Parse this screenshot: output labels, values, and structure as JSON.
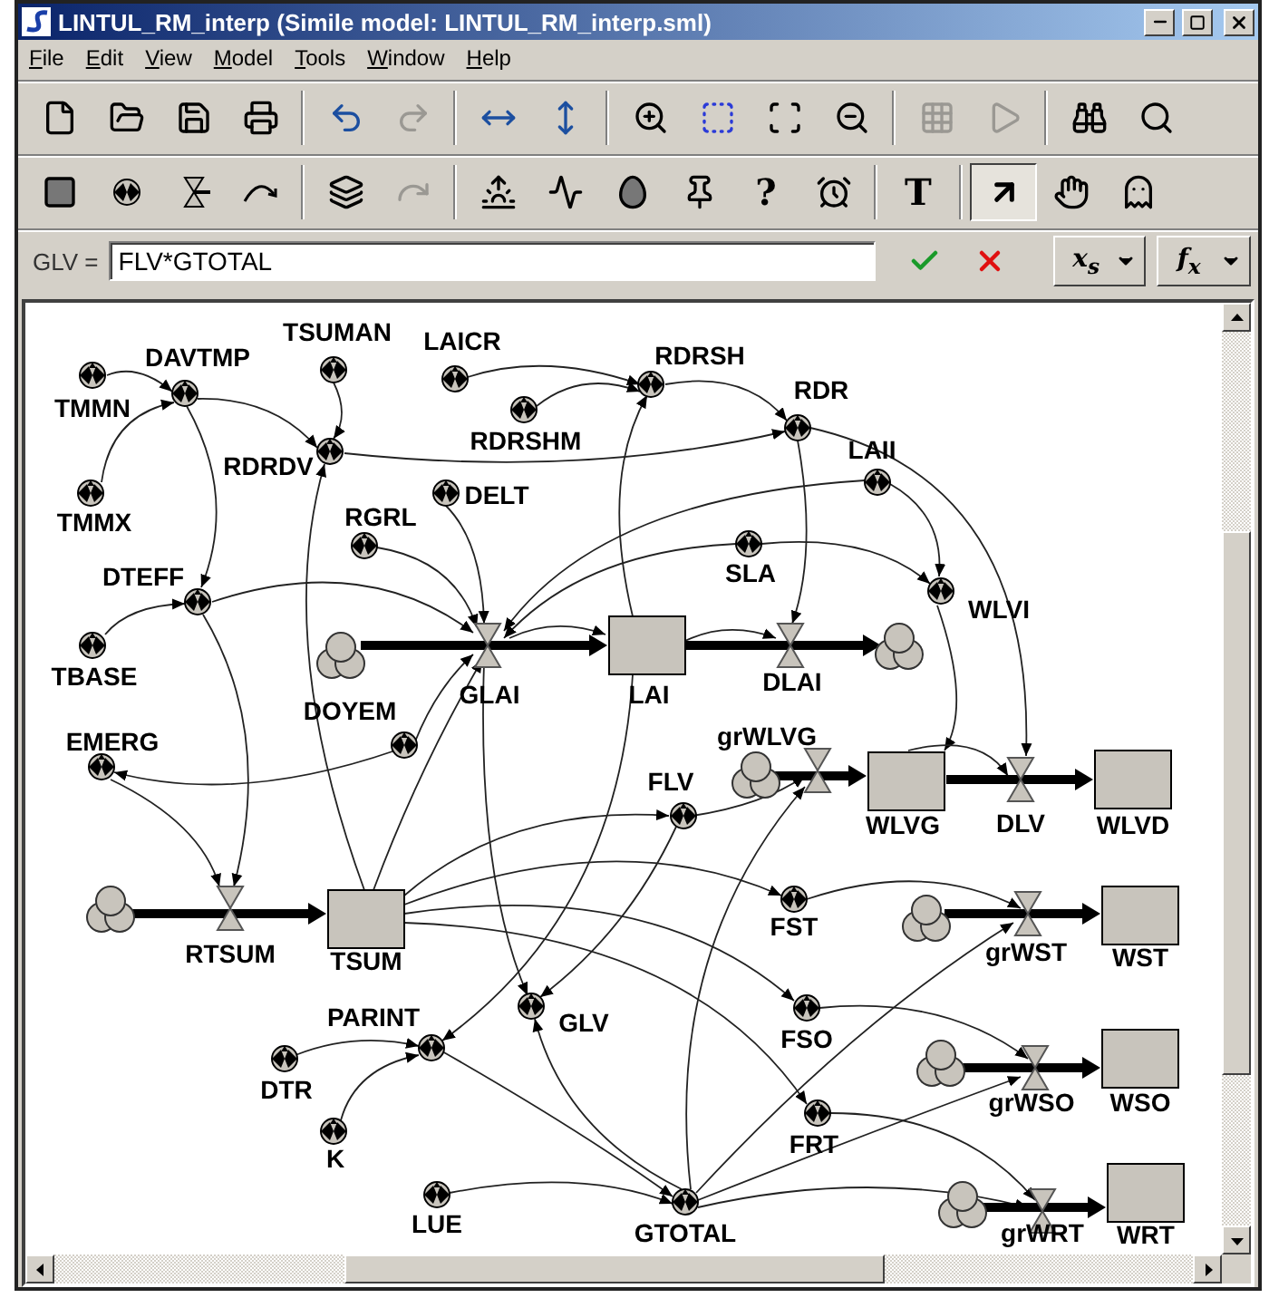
{
  "window": {
    "title": "LINTUL_RM_interp (Simile model: LINTUL_RM_interp.sml)"
  },
  "menu": [
    "File",
    "Edit",
    "View",
    "Model",
    "Tools",
    "Window",
    "Help"
  ],
  "toolbars": [
    [
      {
        "disabled": false
      },
      {
        "disabled": false
      },
      {
        "disabled": false
      },
      {
        "disabled": false
      },
      {
        "disabled": false
      },
      {
        "disabled": true
      },
      {
        "disabled": false
      },
      {
        "disabled": false
      },
      {
        "disabled": false
      },
      {
        "disabled": false
      },
      {
        "disabled": false
      },
      {
        "disabled": false
      },
      {
        "disabled": true
      },
      {
        "disabled": true
      },
      {
        "disabled": false
      },
      {
        "disabled": false
      }
    ],
    [
      {
        "disabled": false,
        "selected": false
      },
      {
        "disabled": false,
        "selected": false
      },
      {
        "disabled": false,
        "selected": false
      },
      {
        "disabled": false,
        "selected": false
      },
      {
        "disabled": false,
        "selected": false
      },
      {
        "disabled": true,
        "selected": false
      },
      {
        "disabled": false,
        "selected": false
      },
      {
        "disabled": false,
        "selected": false
      },
      {
        "disabled": false,
        "selected": false
      },
      {
        "disabled": false,
        "selected": false
      },
      {
        "text": "?",
        "disabled": false,
        "selected": false
      },
      {
        "disabled": false,
        "selected": false
      },
      {
        "text": "T",
        "disabled": false,
        "selected": false
      },
      {
        "disabled": false,
        "selected": true
      },
      {
        "disabled": false,
        "selected": false
      },
      {
        "disabled": false,
        "selected": false
      }
    ]
  ],
  "formula": {
    "label": "GLV =",
    "value": "FLV*GTOTAL",
    "dropdowns": [
      "x$_{s}$",
      "f$_{x}$"
    ]
  },
  "diagram": {
    "nodes": [
      {
        "kind": "variable",
        "label": "TSUMAN"
      },
      {
        "kind": "variable",
        "label": "TMMN"
      },
      {
        "kind": "variable",
        "label": "LAICR"
      },
      {
        "kind": "variable",
        "label": "RDRSH"
      },
      {
        "kind": "variable",
        "label": "DAVTMP"
      },
      {
        "kind": "variable",
        "label": "RDRSHM"
      },
      {
        "kind": "variable",
        "label": "RDR"
      },
      {
        "kind": "variable",
        "label": "RDRDV"
      },
      {
        "kind": "variable",
        "label": "LAII"
      },
      {
        "kind": "variable",
        "label": "TMMX"
      },
      {
        "kind": "variable",
        "label": "DELT"
      },
      {
        "kind": "variable",
        "label": "SLA"
      },
      {
        "kind": "variable",
        "label": "RGRL"
      },
      {
        "kind": "variable",
        "label": "WLVI"
      },
      {
        "kind": "variable",
        "label": "DTEFF"
      },
      {
        "kind": "compartment",
        "label": "LAI"
      },
      {
        "kind": "variable",
        "label": "TBASE"
      },
      {
        "kind": "cloud"
      },
      {
        "kind": "flow",
        "label": "GLAI"
      },
      {
        "kind": "flow",
        "label": "DLAI"
      },
      {
        "kind": "cloud"
      },
      {
        "kind": "variable",
        "label": "DOYEM"
      },
      {
        "kind": "variable",
        "label": "EMERG"
      },
      {
        "kind": "compartment",
        "label": "WLVG"
      },
      {
        "kind": "compartment",
        "label": "WLVD"
      },
      {
        "kind": "cloud"
      },
      {
        "kind": "flow",
        "label": "grWLVG"
      },
      {
        "kind": "flow",
        "label": "DLV"
      },
      {
        "kind": "variable",
        "label": "FLV"
      },
      {
        "kind": "compartment",
        "label": "TSUM"
      },
      {
        "kind": "compartment",
        "label": "WST"
      },
      {
        "kind": "variable",
        "label": "FST"
      },
      {
        "kind": "cloud"
      },
      {
        "kind": "flow",
        "label": "RTSUM"
      },
      {
        "kind": "cloud"
      },
      {
        "kind": "flow",
        "label": "grWST"
      },
      {
        "kind": "variable",
        "label": "GLV"
      },
      {
        "kind": "variable",
        "label": "FSO"
      },
      {
        "kind": "compartment",
        "label": "WSO"
      },
      {
        "kind": "variable",
        "label": "PARINT"
      },
      {
        "kind": "variable",
        "label": "DTR"
      },
      {
        "kind": "cloud"
      },
      {
        "kind": "flow",
        "label": "grWSO"
      },
      {
        "kind": "variable",
        "label": "FRT"
      },
      {
        "kind": "variable",
        "label": "K"
      },
      {
        "kind": "compartment",
        "label": "WRT"
      },
      {
        "kind": "variable",
        "label": "LUE"
      },
      {
        "kind": "variable",
        "label": "GTOTAL"
      },
      {
        "kind": "cloud"
      },
      {
        "kind": "flow",
        "label": "grWRT"
      }
    ]
  }
}
